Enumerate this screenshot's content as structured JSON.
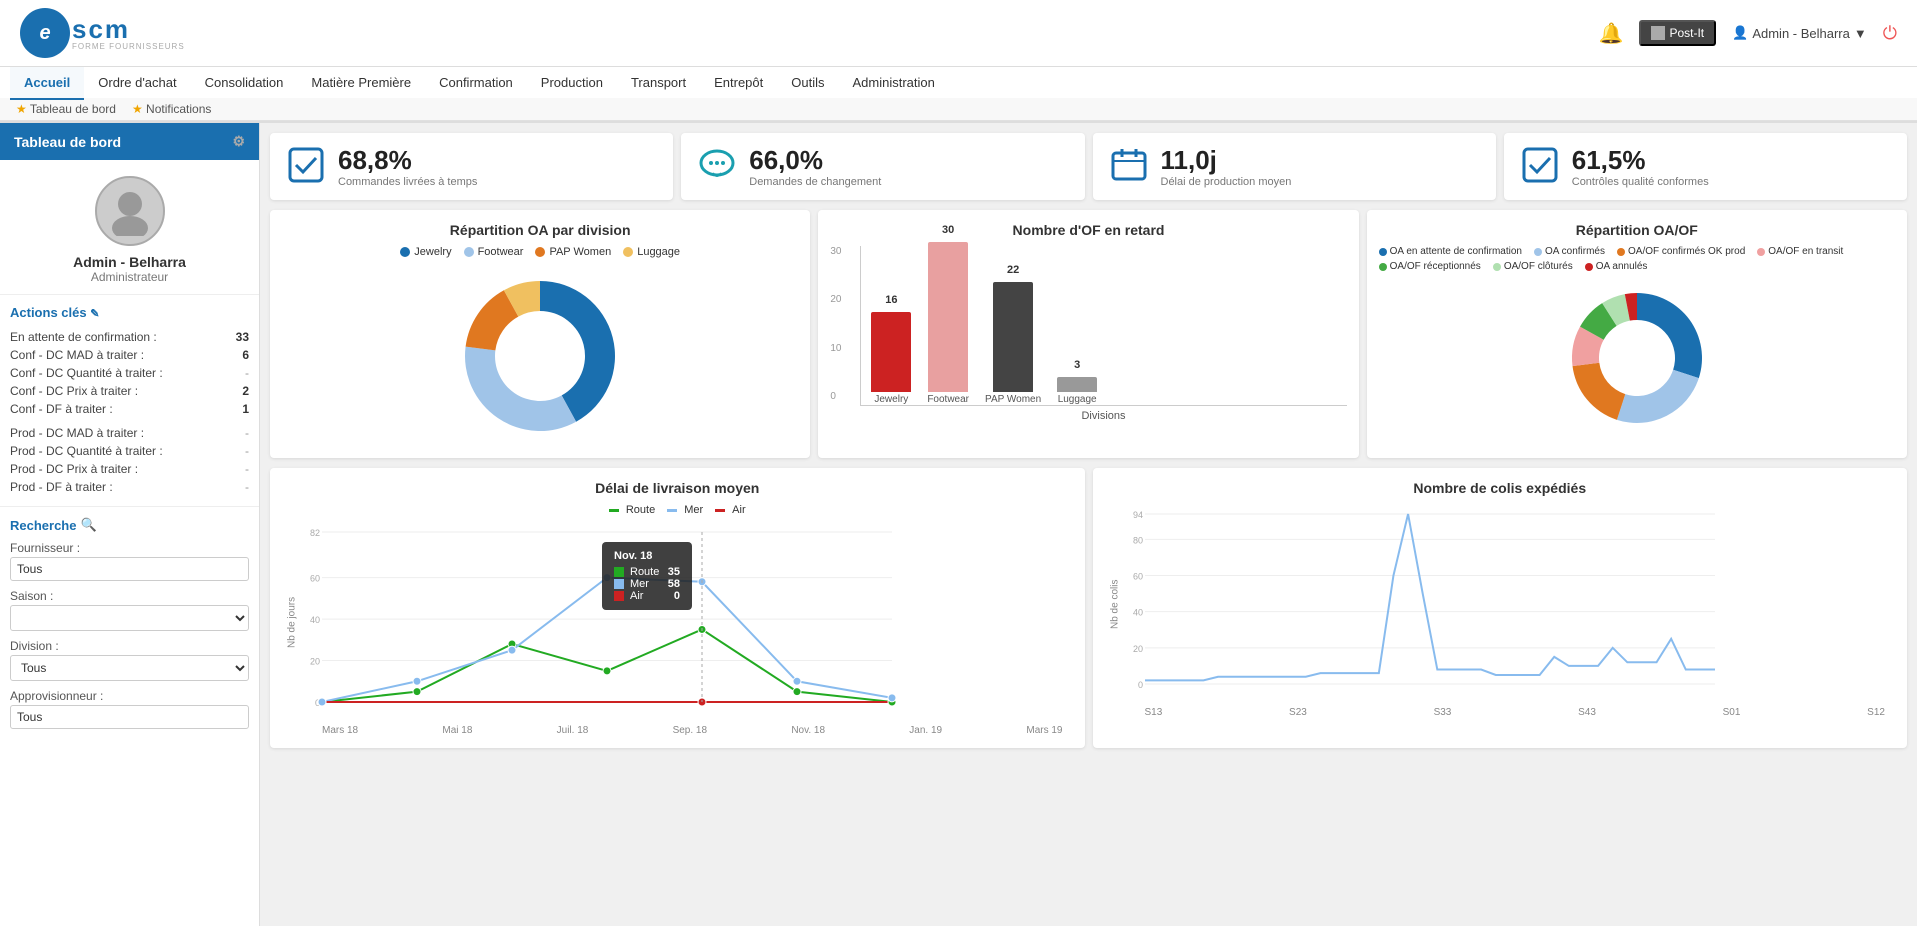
{
  "header": {
    "logo_letter": "e",
    "logo_name": "scm",
    "logo_sub": "FORME FOURNISSEURS",
    "bell_icon": "🔔",
    "postit_label": "Post-It",
    "postit_icon": "▪",
    "admin_label": "Admin - Belharra",
    "power_icon": "⏻"
  },
  "nav": {
    "tabs": [
      "Accueil",
      "Ordre d'achat",
      "Consolidation",
      "Matière Première",
      "Confirmation",
      "Production",
      "Transport",
      "Entrepôt",
      "Outils",
      "Administration"
    ],
    "active": "Accueil",
    "breadcrumbs": [
      "Tableau de bord",
      "Notifications"
    ]
  },
  "sidebar": {
    "title": "Tableau de bord",
    "username": "Admin - Belharra",
    "role": "Administrateur",
    "actions_title": "Actions clés",
    "actions": [
      {
        "label": "En attente de confirmation :",
        "value": "33"
      },
      {
        "label": "Conf - DC MAD à traiter :",
        "value": "6"
      },
      {
        "label": "Conf - DC Quantité à traiter :",
        "value": "-"
      },
      {
        "label": "Conf - DC Prix à traiter :",
        "value": "2"
      },
      {
        "label": "Conf - DF à traiter :",
        "value": "1"
      },
      {
        "label": "Prod - DC MAD à traiter :",
        "value": "-"
      },
      {
        "label": "Prod - DC Quantité à traiter :",
        "value": "-"
      },
      {
        "label": "Prod - DC Prix à traiter :",
        "value": "-"
      },
      {
        "label": "Prod - DF à traiter :",
        "value": "-"
      }
    ],
    "search_title": "Recherche",
    "fournisseur_label": "Fournisseur :",
    "fournisseur_value": "Tous",
    "saison_label": "Saison :",
    "saison_value": "",
    "division_label": "Division :",
    "division_value": "Tous",
    "approv_label": "Approvisionneur :",
    "approv_value": "Tous"
  },
  "kpis": [
    {
      "icon": "✔",
      "value": "68,8%",
      "label": "Commandes livrées à temps"
    },
    {
      "icon": "💬",
      "value": "66,0%",
      "label": "Demandes de changement"
    },
    {
      "icon": "📅",
      "value": "11,0j",
      "label": "Délai de production moyen"
    },
    {
      "icon": "✔",
      "value": "61,5%",
      "label": "Contrôles qualité conformes"
    }
  ],
  "oa_division": {
    "title": "Répartition OA par division",
    "legend": [
      {
        "label": "Jewelry",
        "color": "#1a6faf"
      },
      {
        "label": "Footwear",
        "color": "#a0c4e8"
      },
      {
        "label": "PAP Women",
        "color": "#e07820"
      },
      {
        "label": "Luggage",
        "color": "#f0c060"
      }
    ],
    "segments": [
      {
        "label": "Jewelry",
        "color": "#1a6faf",
        "pct": 42
      },
      {
        "label": "Footwear",
        "color": "#a0c4e8",
        "pct": 35
      },
      {
        "label": "PAP Women",
        "color": "#e07820",
        "pct": 15
      },
      {
        "label": "Luggage",
        "color": "#f0c060",
        "pct": 8
      }
    ]
  },
  "retard": {
    "title": "Nombre d'OF en retard",
    "xlabel": "Divisions",
    "bars": [
      {
        "label": "Jewelry",
        "value": 16,
        "color": "#cc2222"
      },
      {
        "label": "Footwear",
        "value": 30,
        "color": "#e8a0a0"
      },
      {
        "label": "PAP Women",
        "value": 22,
        "color": "#444"
      },
      {
        "label": "Luggage",
        "value": 3,
        "color": "#999"
      }
    ],
    "y_labels": [
      "30",
      "20",
      "10",
      "0"
    ]
  },
  "oaof": {
    "title": "Répartition OA/OF",
    "legend": [
      {
        "label": "OA en attente de confirmation",
        "color": "#1a6faf"
      },
      {
        "label": "OA confirmés",
        "color": "#a0c4e8"
      },
      {
        "label": "OA/OF confirmés OK prod",
        "color": "#e07820"
      },
      {
        "label": "OA/OF en transit",
        "color": "#f0a0a0"
      },
      {
        "label": "OA/OF réceptionnés",
        "color": "#44aa44"
      },
      {
        "label": "OA/OF clôturés",
        "color": "#b0e0b0"
      },
      {
        "label": "OA annulés",
        "color": "#cc2222"
      }
    ],
    "segments": [
      {
        "pct": 30,
        "color": "#1a6faf"
      },
      {
        "pct": 25,
        "color": "#a0c4e8"
      },
      {
        "pct": 18,
        "color": "#e07820"
      },
      {
        "pct": 10,
        "color": "#f0a0a0"
      },
      {
        "pct": 8,
        "color": "#44aa44"
      },
      {
        "pct": 6,
        "color": "#b0e0b0"
      },
      {
        "pct": 3,
        "color": "#cc2222"
      }
    ]
  },
  "livraison": {
    "title": "Délai de livraison moyen",
    "y_label": "Nb de jours",
    "x_labels": [
      "Mars 18",
      "Mai 18",
      "Juil. 18",
      "Sep. 18",
      "Nov. 18",
      "Jan. 19",
      "Mars 19"
    ],
    "legend": [
      {
        "label": "Route",
        "color": "#22aa22"
      },
      {
        "label": "Mer",
        "color": "#88bbee"
      },
      {
        "label": "Air",
        "color": "#cc2222"
      }
    ],
    "y_ticks": [
      "82",
      "60",
      "40",
      "20",
      "0"
    ],
    "tooltip": {
      "title": "Nov. 18",
      "rows": [
        {
          "label": "Route",
          "value": "35",
          "color": "#22aa22"
        },
        {
          "label": "Mer",
          "value": "58",
          "color": "#88bbee"
        },
        {
          "label": "Air",
          "value": "0",
          "color": "#cc2222"
        }
      ]
    }
  },
  "colis": {
    "title": "Nombre de colis expédiés",
    "y_label": "Nb de colis",
    "x_labels": [
      "S13",
      "S23",
      "S33",
      "S43",
      "S01",
      "S12"
    ],
    "y_ticks": [
      "94",
      "80",
      "60",
      "40",
      "20",
      "0"
    ]
  }
}
